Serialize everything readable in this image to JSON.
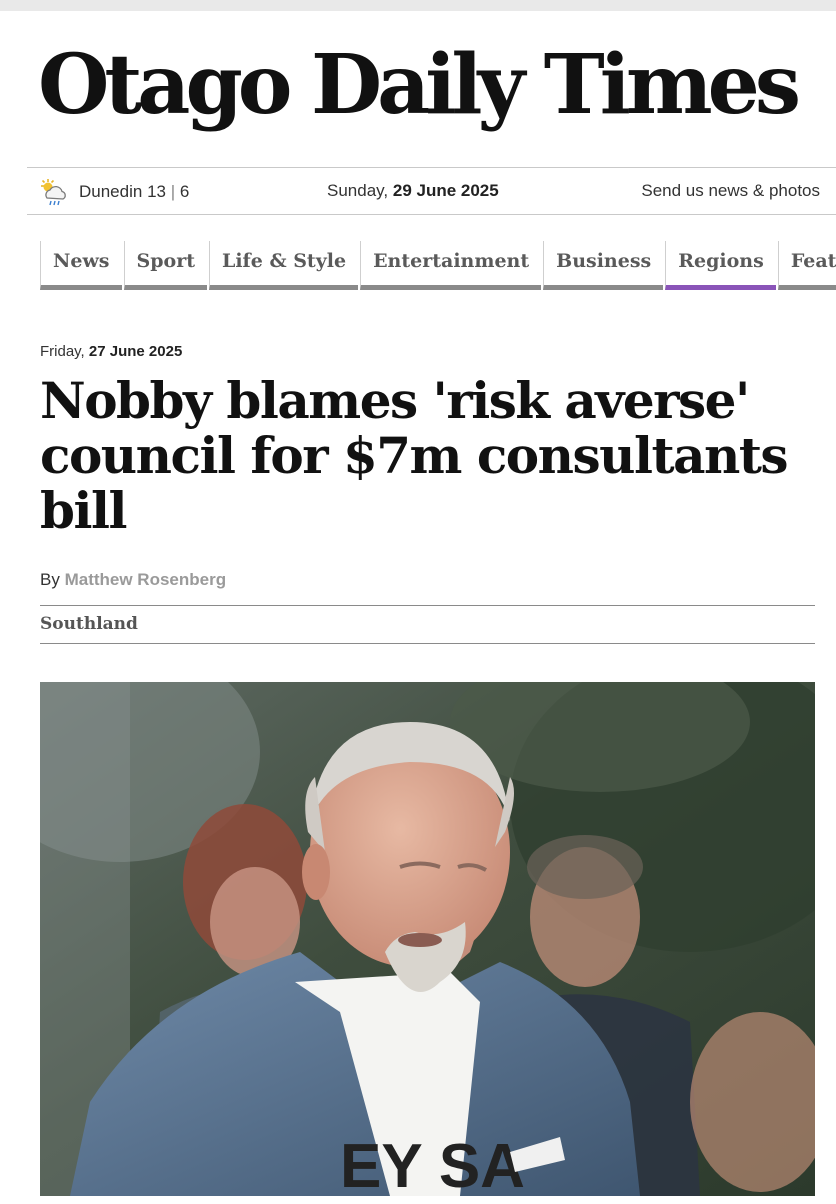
{
  "masthead": {
    "title": "Otago Daily Times"
  },
  "infobar": {
    "weather": {
      "icon": "partly-cloudy-rain-icon",
      "location": "Dunedin",
      "high": "13",
      "separator": "|",
      "low": "6"
    },
    "date": {
      "weekday": "Sunday,",
      "date": "29 June 2025"
    },
    "send_news": "Send us news & photos"
  },
  "nav": {
    "items": [
      {
        "label": "News"
      },
      {
        "label": "Sport"
      },
      {
        "label": "Life & Style"
      },
      {
        "label": "Entertainment"
      },
      {
        "label": "Business"
      },
      {
        "label": "Regions",
        "active": true
      },
      {
        "label": "Features"
      }
    ],
    "active_color": "#8a54b8"
  },
  "article": {
    "date_weekday": "Friday,",
    "date": "27 June 2025",
    "headline": "Nobby blames 'risk averse' council for $7m consultants bill",
    "byline_prefix": "By",
    "author": "Matthew Rosenberg",
    "section": "Southland"
  },
  "photo": {
    "shirt_text": "EY SA"
  }
}
